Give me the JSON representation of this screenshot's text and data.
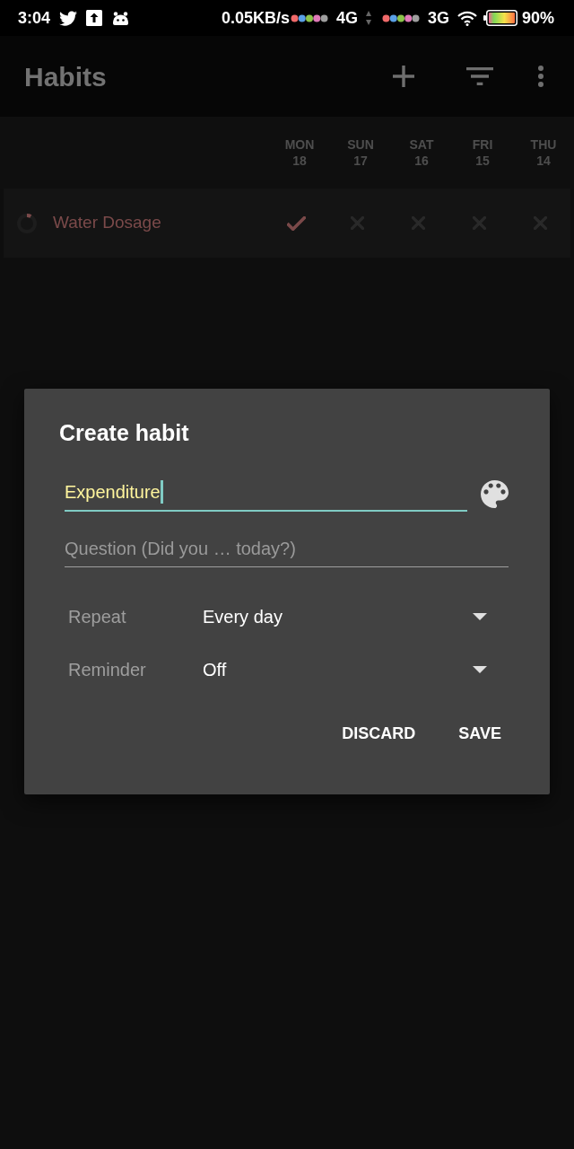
{
  "status_bar": {
    "time": "3:04",
    "network_speed": "0.05KB/s",
    "sim_1_type": "4G",
    "sim_2_type": "3G",
    "battery": "90%"
  },
  "app_bar": {
    "title": "Habits"
  },
  "day_header": [
    {
      "weekday": "MON",
      "date": "18"
    },
    {
      "weekday": "SUN",
      "date": "17"
    },
    {
      "weekday": "SAT",
      "date": "16"
    },
    {
      "weekday": "FRI",
      "date": "15"
    },
    {
      "weekday": "THU",
      "date": "14"
    }
  ],
  "habits": [
    {
      "name": "Water Dosage",
      "color": "#7b4a4a",
      "level": 0.08,
      "checks": [
        {
          "done": true
        },
        {
          "done": false
        },
        {
          "done": false
        },
        {
          "done": false
        },
        {
          "done": false
        }
      ]
    }
  ],
  "dialog": {
    "title": "Create habit",
    "name_field": {
      "value": "Expenditure",
      "focused": true
    },
    "question_field": {
      "placeholder": "Question (Did you … today?)"
    },
    "settings": [
      {
        "label": "Repeat",
        "value": "Every day"
      },
      {
        "label": "Reminder",
        "value": "Off"
      }
    ],
    "buttons": [
      "DISCARD",
      "SAVE"
    ]
  }
}
